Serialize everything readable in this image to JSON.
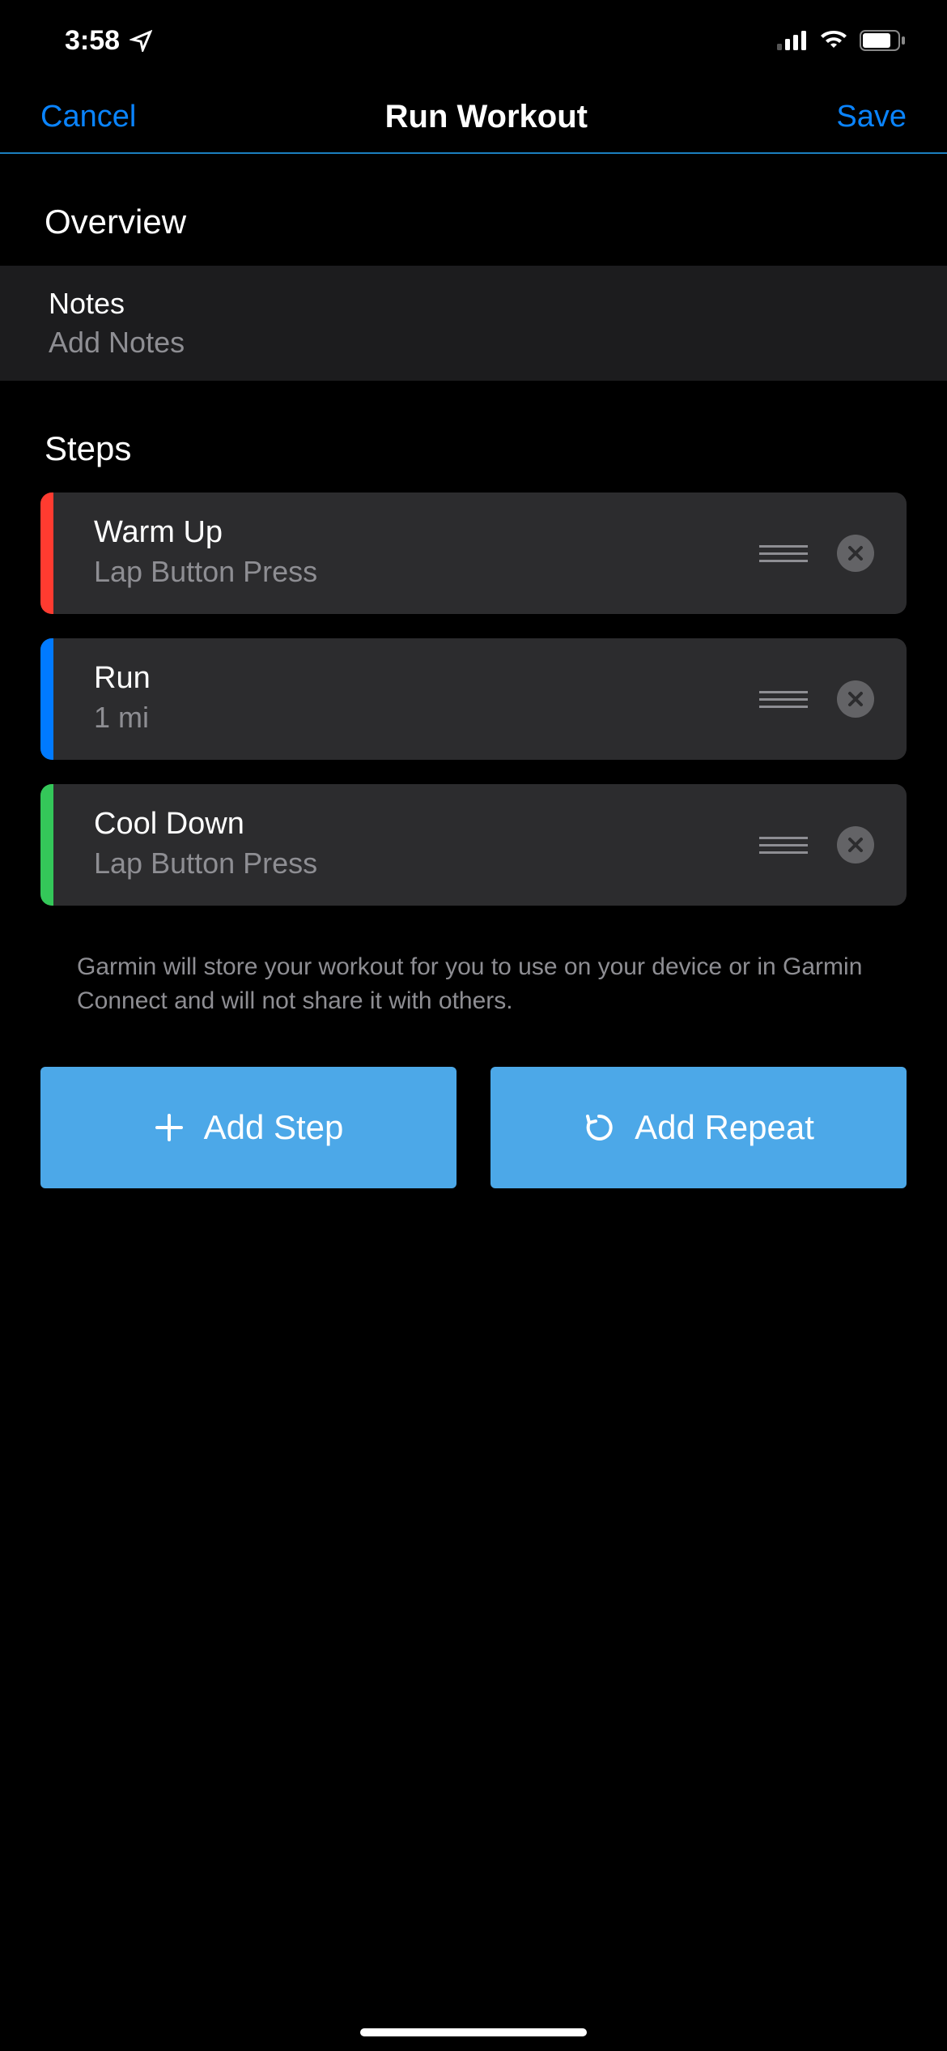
{
  "status": {
    "time": "3:58"
  },
  "nav": {
    "cancel": "Cancel",
    "title": "Run Workout",
    "save": "Save"
  },
  "overview": {
    "header": "Overview",
    "notes_label": "Notes",
    "notes_placeholder": "Add Notes"
  },
  "steps": {
    "header": "Steps",
    "items": [
      {
        "title": "Warm Up",
        "sub": "Lap Button Press",
        "color": "red"
      },
      {
        "title": "Run",
        "sub": "1 mi",
        "color": "blue"
      },
      {
        "title": "Cool Down",
        "sub": "Lap Button Press",
        "color": "green"
      }
    ]
  },
  "disclosure": "Garmin will store your workout for you to use on your device or in Garmin Connect and will not share it with others.",
  "buttons": {
    "add_step": "Add Step",
    "add_repeat": "Add Repeat"
  }
}
